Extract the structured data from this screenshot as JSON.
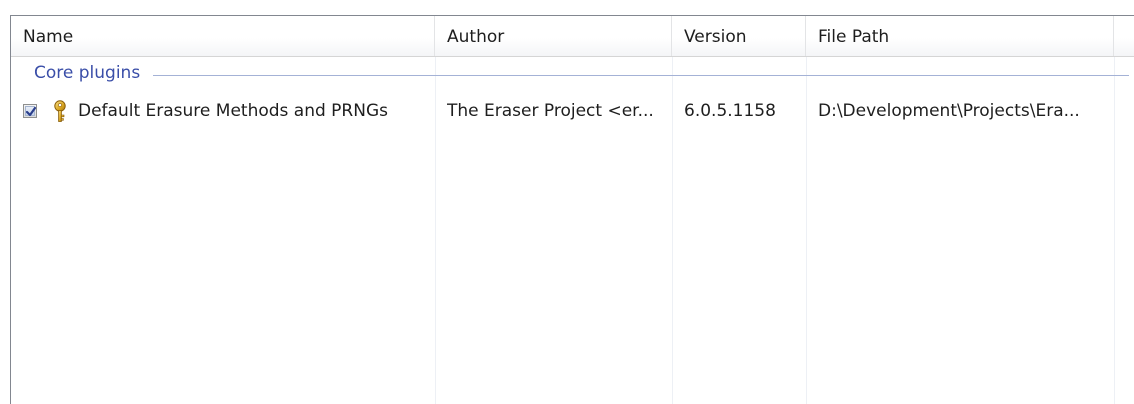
{
  "columns": {
    "name": "Name",
    "author": "Author",
    "version": "Version",
    "file_path": "File Path"
  },
  "groups": [
    {
      "label": "Core plugins",
      "items": [
        {
          "checked": true,
          "icon": "key-icon",
          "name": "Default Erasure Methods and PRNGs",
          "author": "The Eraser Project <er...",
          "version": "6.0.5.1158",
          "file_path": "D:\\Development\\Projects\\Era..."
        }
      ]
    }
  ],
  "colors": {
    "group_text": "#3a4ea8",
    "group_line": "#a4b2d6",
    "checkbox_mark": "#2b3f8c",
    "key_gold": "#d9a520"
  }
}
